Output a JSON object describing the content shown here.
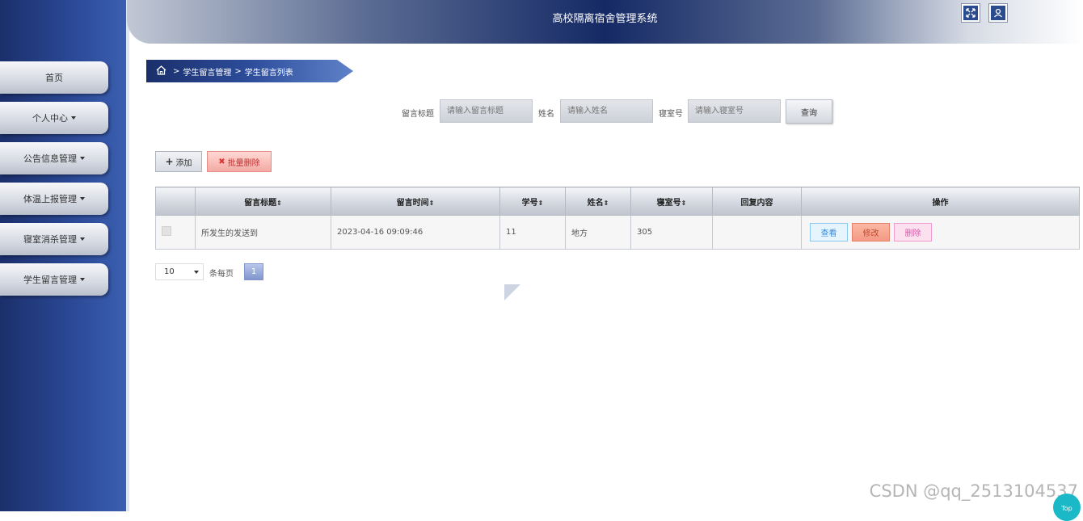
{
  "header": {
    "title": "高校隔离宿舍管理系统",
    "fullscreen_icon": "fullscreen-icon",
    "user_icon": "user-icon"
  },
  "sidebar": {
    "items": [
      {
        "label": "首页",
        "has_caret": false
      },
      {
        "label": "个人中心",
        "has_caret": true
      },
      {
        "label": "公告信息管理",
        "has_caret": true
      },
      {
        "label": "体温上报管理",
        "has_caret": true
      },
      {
        "label": "寝室消杀管理",
        "has_caret": true
      },
      {
        "label": "学生留言管理",
        "has_caret": true
      }
    ]
  },
  "breadcrumb": {
    "home_icon": "home-icon",
    "sep1": ">",
    "level1": "学生留言管理",
    "sep2": ">",
    "level2": "学生留言列表"
  },
  "search": {
    "title_label": "留言标题",
    "title_placeholder": "请输入留言标题",
    "name_label": "姓名",
    "name_placeholder": "请输入姓名",
    "room_label": "寝室号",
    "room_placeholder": "请输入寝室号",
    "query_label": "查询"
  },
  "toolbar": {
    "add_label": "添加",
    "add_icon": "plus-icon",
    "batch_delete_label": "批量删除",
    "batch_delete_icon": "x-icon"
  },
  "table": {
    "columns": [
      "留言标题",
      "留言时间",
      "学号",
      "姓名",
      "寝室号",
      "回复内容",
      "操作"
    ],
    "rows": [
      {
        "title": "所发生的发送到",
        "time": "2023-04-16 09:09:46",
        "student_no": "11",
        "name": "地方",
        "room": "305",
        "reply": "",
        "actions": {
          "view": "查看",
          "edit": "修改",
          "delete": "删除"
        }
      }
    ]
  },
  "pager": {
    "page_size": "10",
    "per_page_label": "条每页",
    "current_page": "1"
  },
  "watermark": "CSDN @qq_2513104537",
  "back_to_top": "Top",
  "colors": {
    "sidebar_bg": "#2c4a98",
    "header_dark": "#152965",
    "accent_blue": "#2a4c8f"
  }
}
